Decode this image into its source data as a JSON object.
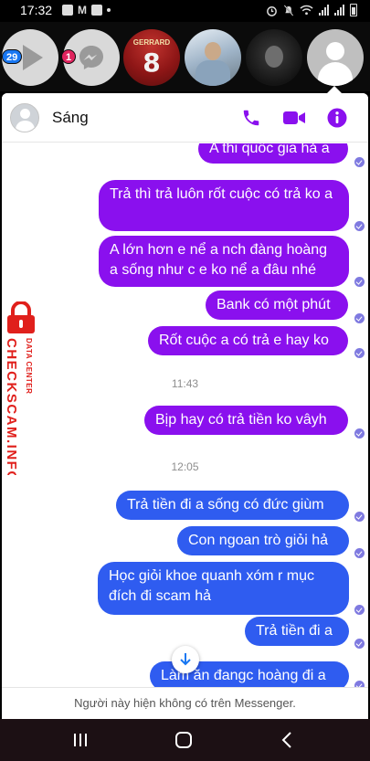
{
  "status_bar": {
    "time": "17:32",
    "left_icons": [
      "photo-icon",
      "messenger-icon",
      "gmail-icon",
      "zalo-icon",
      "dot-icon"
    ],
    "right_icons": [
      "alarm-icon",
      "mute-icon",
      "wifi-icon",
      "signal-icon",
      "signal-icon",
      "battery-icon"
    ]
  },
  "chat_heads": [
    {
      "name": "video-head",
      "badge": "29"
    },
    {
      "name": "messenger-head",
      "badge": "1"
    },
    {
      "name": "gerrard-jersey-head",
      "jersey_text": "GERRARD",
      "jersey_number": "8"
    },
    {
      "name": "person-head"
    },
    {
      "name": "dark-photo-head"
    },
    {
      "name": "default-avatar-head"
    }
  ],
  "chat": {
    "contact_name": "Sáng",
    "accent_color": "#8a10ee",
    "blue_color": "#2f5cf0",
    "messages": [
      {
        "text": "A thi quốc gia hả a"
      },
      {
        "text": "Trả thì trả luôn rốt cuộc có trả ko a"
      },
      {
        "text": "A lớn hơn e nể a nch đàng hoàng a sống như c e ko nể a đâu nhé"
      },
      {
        "text": "Bank có một phút"
      },
      {
        "text": "Rốt cuộc a có trả e hay ko"
      },
      {
        "timestamp": "11:43"
      },
      {
        "text": "Bịp hay có trả tiền ko vâyh"
      },
      {
        "timestamp": "12:05"
      },
      {
        "text": "Trả tiền đi a sống có đức giùm"
      },
      {
        "text": "Con ngoan trò giỏi hả"
      },
      {
        "text": "Học giỏi khoe quanh xóm r mục đích đi scam hả"
      },
      {
        "text": "Trả tiền đi a"
      },
      {
        "text": "Làm ăn đangc hoàng đi a"
      }
    ],
    "timestamps": [
      "11:43",
      "12:05"
    ],
    "footer_note": "Người này hiện không có trên Messenger."
  },
  "watermark": {
    "brand": "CHECKSCAM.INFO",
    "subtitle": "DATA CENTER",
    "color": "#e0201c"
  },
  "nav_bar": {
    "buttons": [
      "recents-button",
      "home-button",
      "back-button"
    ]
  }
}
